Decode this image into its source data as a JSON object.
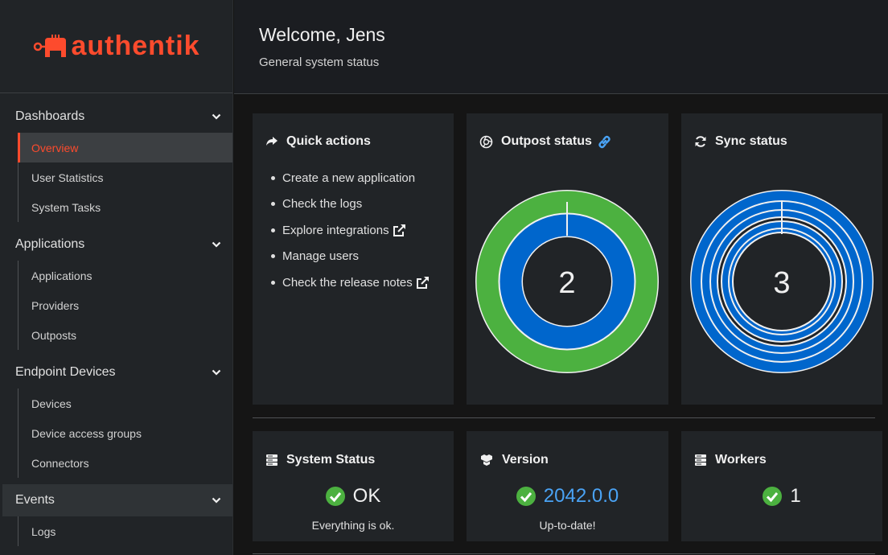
{
  "brand": {
    "name": "authentik"
  },
  "sidebar": {
    "groups": [
      {
        "label": "Dashboards",
        "items": [
          {
            "label": "Overview"
          },
          {
            "label": "User Statistics"
          },
          {
            "label": "System Tasks"
          }
        ]
      },
      {
        "label": "Applications",
        "items": [
          {
            "label": "Applications"
          },
          {
            "label": "Providers"
          },
          {
            "label": "Outposts"
          }
        ]
      },
      {
        "label": "Endpoint Devices",
        "items": [
          {
            "label": "Devices"
          },
          {
            "label": "Device access groups"
          },
          {
            "label": "Connectors"
          }
        ]
      },
      {
        "label": "Events",
        "items": [
          {
            "label": "Logs"
          }
        ]
      }
    ]
  },
  "header": {
    "title": "Welcome, Jens",
    "subtitle": "General system status"
  },
  "quick_actions": {
    "title": "Quick actions",
    "items": [
      {
        "label": "Create a new application"
      },
      {
        "label": "Check the logs"
      },
      {
        "label": "Explore integrations"
      },
      {
        "label": "Manage users"
      },
      {
        "label": "Check the release notes"
      }
    ]
  },
  "outpost_status": {
    "title": "Outpost status",
    "count": "2"
  },
  "sync_status": {
    "title": "Sync status",
    "count": "3"
  },
  "system_status": {
    "title": "System Status",
    "value": "OK",
    "detail": "Everything is ok."
  },
  "version": {
    "title": "Version",
    "value": "2042.0.0",
    "detail": "Up-to-date!"
  },
  "workers": {
    "title": "Workers",
    "value": "1"
  },
  "colors": {
    "accent": "#fd4b2d",
    "green": "#4cb140",
    "blue": "#0066cc",
    "link": "#4aa3f5"
  }
}
